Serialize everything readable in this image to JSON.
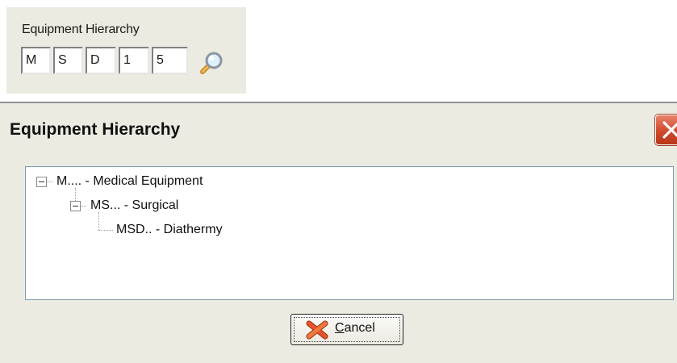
{
  "field": {
    "label": "Equipment Hierarchy",
    "segments": [
      "M",
      "S",
      "D",
      "1",
      "5"
    ],
    "lookup_icon": "magnifier-icon"
  },
  "dialog": {
    "title": "Equipment Hierarchy",
    "close_icon": "close-icon",
    "tree": [
      {
        "code": "M....",
        "description": "Medical Equipment",
        "text": "M.... - Medical Equipment",
        "expanded": true,
        "level": 0
      },
      {
        "code": "MS...",
        "description": "Surgical",
        "text": "MS... - Surgical",
        "expanded": true,
        "level": 1
      },
      {
        "code": "MSD..",
        "description": "Diathermy",
        "text": "MSD.. - Diathermy",
        "level": 2
      }
    ],
    "cancel_button": {
      "mnemonic": "C",
      "rest": "ancel",
      "icon": "cancel-x-icon"
    }
  },
  "colors": {
    "panel_bg": "#ecebe2",
    "close_red": "#cf4a2d",
    "cancel_icon_orange": "#e8542a",
    "tree_border": "#7f9db9"
  }
}
